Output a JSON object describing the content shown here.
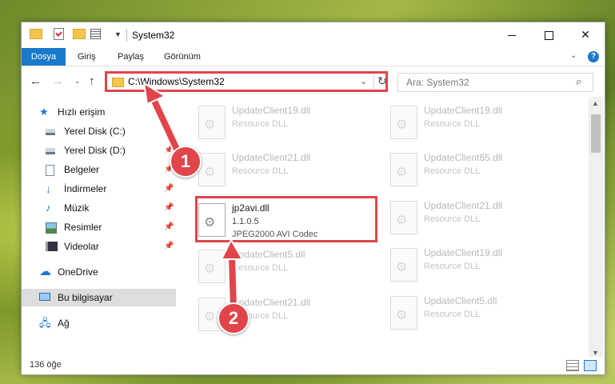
{
  "window": {
    "title": "System32",
    "minimize_glyph": "",
    "maximize_glyph": "",
    "close_glyph": "✕"
  },
  "ribbon": {
    "tabs": [
      "Dosya",
      "Giriş",
      "Paylaş",
      "Görünüm"
    ],
    "help_glyph": "?"
  },
  "address": {
    "path": "C:\\Windows\\System32",
    "search_placeholder": "Ara: System32"
  },
  "sidebar": {
    "quick_access": "Hızlı erişim",
    "items": [
      {
        "label": "Yerel Disk (C:)",
        "pinned": false
      },
      {
        "label": "Yerel Disk (D:)",
        "pinned": true
      },
      {
        "label": "Belgeler",
        "pinned": true
      },
      {
        "label": "İndirmeler",
        "pinned": true
      },
      {
        "label": "Müzik",
        "pinned": true
      },
      {
        "label": "Resimler",
        "pinned": true
      },
      {
        "label": "Videolar",
        "pinned": true
      }
    ],
    "onedrive": "OneDrive",
    "this_pc": "Bu bilgisayar",
    "network": "Ağ"
  },
  "files": {
    "left_column": [
      {
        "name": "UpdateClient19.dll",
        "desc": "Resource DLL"
      },
      {
        "name": "UpdateClient21.dll",
        "desc": "Resource DLL"
      },
      {
        "name": "UpdateClient5.dll",
        "desc": "Resource DLL"
      },
      {
        "name": "UpdateClient21.dll",
        "desc": "Resource DLL"
      }
    ],
    "right_column": [
      {
        "name": "UpdateClient19.dll",
        "desc": "Resource DLL"
      },
      {
        "name": "UpdateClient65.dll",
        "desc": "Resource DLL"
      },
      {
        "name": "UpdateClient21.dll",
        "desc": "Resource DLL"
      },
      {
        "name": "UpdateClient19.dll",
        "desc": "Resource DLL"
      },
      {
        "name": "UpdateClient5.dll",
        "desc": "Resource DLL"
      }
    ],
    "highlighted": {
      "name": "jp2avi.dll",
      "version": "1.1.0.5",
      "desc": "JPEG2000 AVI Codec"
    }
  },
  "status": {
    "item_count": "136 öğe"
  },
  "annotations": {
    "step1": "1",
    "step2": "2",
    "accent": "#e0454a"
  }
}
